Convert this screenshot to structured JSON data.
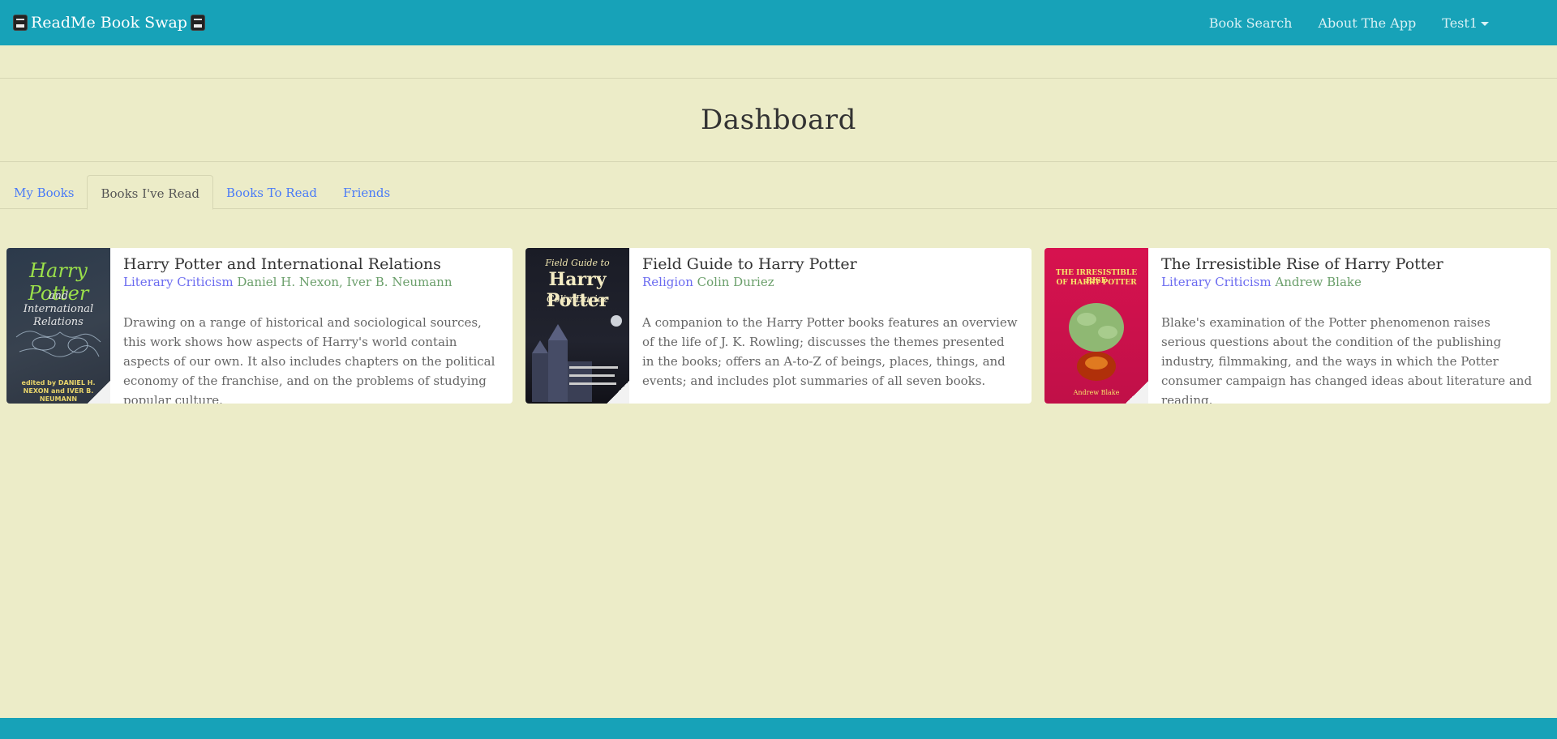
{
  "navbar": {
    "brand": "ReadMe Book Swap",
    "links": [
      "Book Search",
      "About The App",
      "Test1"
    ]
  },
  "page_title": "Dashboard",
  "tabs": [
    {
      "label": "My Books",
      "active": false
    },
    {
      "label": "Books I've Read",
      "active": true
    },
    {
      "label": "Books To Read",
      "active": false
    },
    {
      "label": "Friends",
      "active": false
    }
  ],
  "books": [
    {
      "title": "Harry Potter and International Relations",
      "genre": "Literary Criticism",
      "authors": "Daniel H. Nexon, Iver B. Neumann",
      "description": "Drawing on a range of historical and sociological sources, this work shows how aspects of Harry's world contain aspects of our own. It also includes chapters on the political economy of the franchise, and on the problems of studying popular culture.",
      "cover": {
        "line1": "Harry Potter",
        "line2": "and International Relations",
        "credit": "edited by DANIEL H. NEXON and IVER B. NEUMANN"
      }
    },
    {
      "title": "Field Guide to Harry Potter",
      "genre": "Religion",
      "authors": "Colin Duriez",
      "description": "A companion to the Harry Potter books features an overview of the life of J. K. Rowling; discusses the themes presented in the books; offers an A-to-Z of beings, places, things, and events; and includes plot summaries of all seven books.",
      "cover": {
        "line1": "Field Guide to",
        "line2": "Harry Potter",
        "credit": "Colin Duriez"
      }
    },
    {
      "title": "The Irresistible Rise of Harry Potter",
      "genre": "Literary Criticism",
      "authors": "Andrew Blake",
      "description": "Blake's examination of the Potter phenomenon raises serious questions about the condition of the publishing industry, filmmaking, and the ways in which the Potter consumer campaign has changed ideas about literature and reading.",
      "cover": {
        "line1": "THE IRRESISTIBLE RISE",
        "line2": "OF HARRY POTTER",
        "credit": "Andrew Blake"
      }
    }
  ]
}
